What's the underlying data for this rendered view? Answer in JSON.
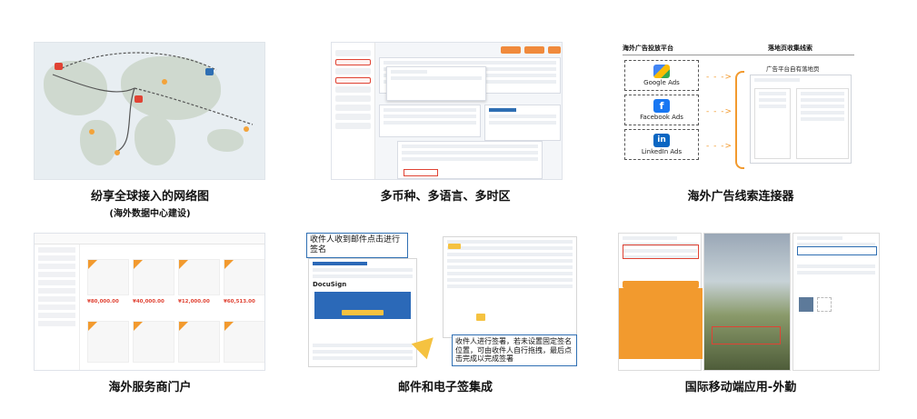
{
  "captions": {
    "network": "纷享全球接入的网络图",
    "network_sub": "(海外数据中心建设)",
    "multi": "多币种、多语言、多时区",
    "ads": "海外广告线索连接器",
    "portal": "海外服务商门户",
    "mail": "邮件和电子签集成",
    "mobile": "国际移动端应用-外勤"
  },
  "ads_tile": {
    "left_header": "海外广告投放平台",
    "right_header": "落地页收集线索",
    "sub_header": "广告平台自有落地页",
    "platforms": [
      "Google Ads",
      "Facebook Ads",
      "LinkedIn Ads"
    ],
    "arrows": "- - ->"
  },
  "mail_tile": {
    "note_top": "收件人收到邮件点击进行签名",
    "note_bottom": "收件人进行签署，若未设置固定签名位置，可由收件人自行拖拽，最后点击完成以完成签署",
    "brand": "DocuSign"
  },
  "portal_tile": {
    "prices": [
      "¥80,000.00",
      "¥40,000.00",
      "¥12,000.00",
      "¥60,513.00"
    ]
  },
  "colors": {
    "accent_orange": "#f29a2e",
    "accent_red": "#e04334",
    "accent_blue": "#2f6fb3"
  }
}
